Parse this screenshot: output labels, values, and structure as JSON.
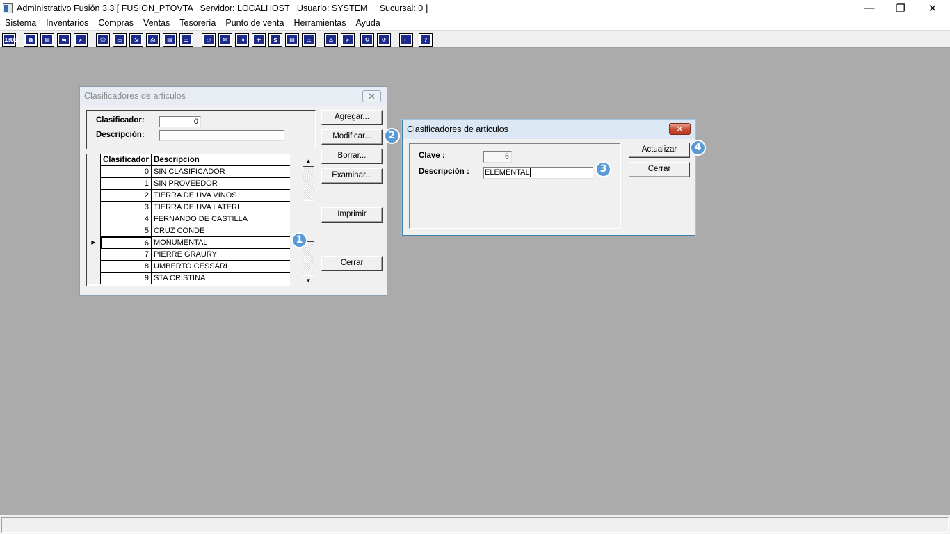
{
  "window": {
    "title": "Administrativo Fusión 3.3 [ FUSION_PTOVTA   Servidor: LOCALHOST   Usuario: SYSTEM     Sucursal: 0 ]",
    "minimize": "—",
    "restore": "❐",
    "close": "✕"
  },
  "menu": [
    "Sistema",
    "Inventarios",
    "Compras",
    "Ventas",
    "Tesorería",
    "Punto de venta",
    "Herramientas",
    "Ayuda"
  ],
  "toolbar": {
    "icons": [
      "catalog-icon",
      "copy-icon",
      "clipboard-icon",
      "transfer-icon",
      "search-doc-icon",
      "person-icon",
      "folder-icon",
      "import-icon",
      "print-icon",
      "document-icon",
      "list-icon",
      "binoculars-icon",
      "envelope-icon",
      "export-icon",
      "add-icon",
      "dollar-icon",
      "page-icon",
      "report-icon",
      "home-icon",
      "zoom-icon",
      "refresh-icon",
      "undo-icon",
      "back-icon",
      "help-icon"
    ],
    "glyphs": [
      "1:01",
      "⧉",
      "▤",
      "⇆",
      "⌕",
      "☺",
      "▭",
      "⇲",
      "⎙",
      "▤",
      "☰",
      "⚇",
      "✉",
      "⇥",
      "✚",
      "$",
      "▤",
      "☷",
      "⌂",
      "⌕",
      "↻",
      "↺",
      "←",
      "?"
    ]
  },
  "dialog_list": {
    "title": "Clasificadores de articulos",
    "close": "✕",
    "clasificador_label": "Clasificador:",
    "clasificador_value": "0",
    "descripcion_label": "Descripción:",
    "descripcion_value": "",
    "buttons": {
      "agregar": "Agregar...",
      "modificar": "Modificar...",
      "borrar": "Borrar...",
      "examinar": "Examinar...",
      "imprimir": "Imprimir",
      "cerrar": "Cerrar"
    },
    "grid": {
      "headers": [
        "Clasificador",
        "Descripcion"
      ],
      "rows": [
        {
          "code": "0",
          "desc": "SIN CLASIFICADOR"
        },
        {
          "code": "1",
          "desc": "SIN PROVEEDOR"
        },
        {
          "code": "2",
          "desc": "TIERRA DE UVA VINOS"
        },
        {
          "code": "3",
          "desc": "TIERRA DE UVA LATERI"
        },
        {
          "code": "4",
          "desc": "FERNANDO DE CASTILLA"
        },
        {
          "code": "5",
          "desc": "CRUZ CONDE"
        },
        {
          "code": "6",
          "desc": "MONUMENTAL"
        },
        {
          "code": "7",
          "desc": "PIERRE GRAURY"
        },
        {
          "code": "8",
          "desc": "UMBERTO CESSARI"
        },
        {
          "code": "9",
          "desc": "STA CRISTINA"
        }
      ],
      "current_row": 6,
      "current_indicator": "▶",
      "scroll_up": "▲",
      "scroll_down": "▼"
    }
  },
  "dialog_edit": {
    "title": "Clasificadores de articulos",
    "close": "✕",
    "clave_label": "Clave :",
    "clave_value": "6",
    "descripcion_label": "Descripción :",
    "descripcion_value": "ELEMENTAL",
    "buttons": {
      "actualizar": "Actualizar",
      "cerrar": "Cerrar"
    }
  },
  "markers": [
    "1",
    "2",
    "3",
    "4"
  ],
  "colors": {
    "desktop": "#ababab",
    "marker": "#5b9bd5",
    "toolbar_icon": "#1c2a8c",
    "close_active": "#c74b33"
  }
}
